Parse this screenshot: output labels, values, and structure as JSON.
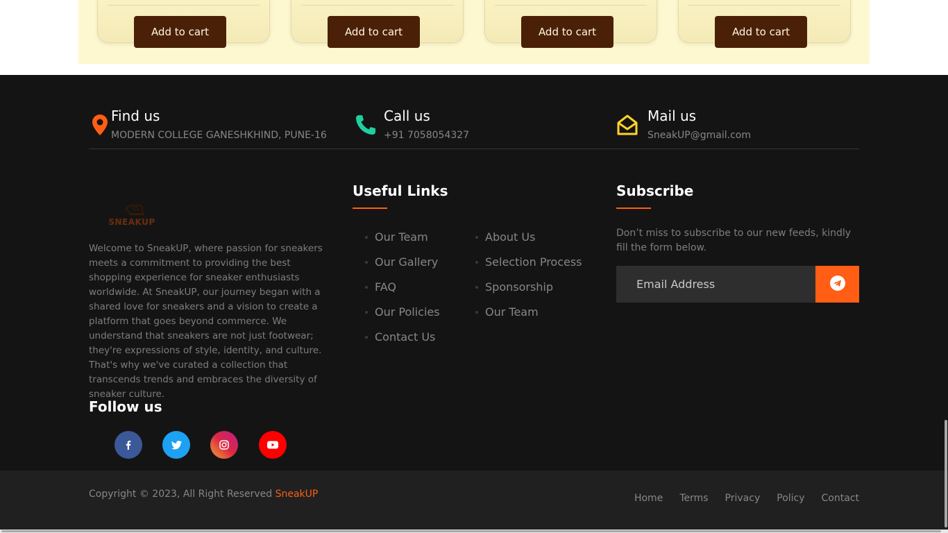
{
  "products": {
    "cart_label": "Add to cart"
  },
  "contact": {
    "find": {
      "title": "Find us",
      "value": "MODERN COLLEGE GANESHKHIND, PUNE-16"
    },
    "call": {
      "title": "Call us",
      "value": "+91 7058054327"
    },
    "mail": {
      "title": "Mail us",
      "value": "SneakUP@gmail.com"
    }
  },
  "about": {
    "logo_text": "SNEAKUP",
    "description": "Welcome to SneakUP, where passion for sneakers meets a commitment to providing the best shopping experience for sneaker enthusiasts worldwide. At SneakUP, our journey began with a shared love for sneakers and a vision to create a platform that goes beyond commerce. We understand that sneakers are not just footwear; they're expressions of style, identity, and culture. That's why we've curated a collection that transcends trends and embraces the diversity of sneaker culture.",
    "follow_title": "Follow us",
    "social": [
      {
        "name": "facebook-icon",
        "color": "#3b5998"
      },
      {
        "name": "twitter-icon",
        "color": "#1da1f2"
      },
      {
        "name": "instagram-icon",
        "color": "#e4405f"
      },
      {
        "name": "youtube-icon",
        "color": "#ff0000"
      }
    ]
  },
  "useful_links": {
    "title": "Useful Links",
    "col1": [
      "Our Team",
      "Our Gallery",
      "FAQ",
      "Our Policies",
      "Contact Us"
    ],
    "col2": [
      "About Us",
      "Selection Process",
      "Sponsorship",
      "Our Team"
    ]
  },
  "subscribe": {
    "title": "Subscribe",
    "text": "Don’t miss to subscribe to our new feeds, kindly fill the form below.",
    "placeholder": "Email Address",
    "button_icon": "telegram-icon"
  },
  "copyright": {
    "text": "Copyright © 2023, All Right Reserved ",
    "brand": "SneakUP",
    "menu": [
      "Home",
      "Terms",
      "Privacy",
      "Policy",
      "Contact"
    ]
  },
  "colors": {
    "accent": "#ff5e14",
    "footer_bg": "#151414",
    "copyright_bg": "#202020",
    "cart_button": "#4a2106"
  }
}
